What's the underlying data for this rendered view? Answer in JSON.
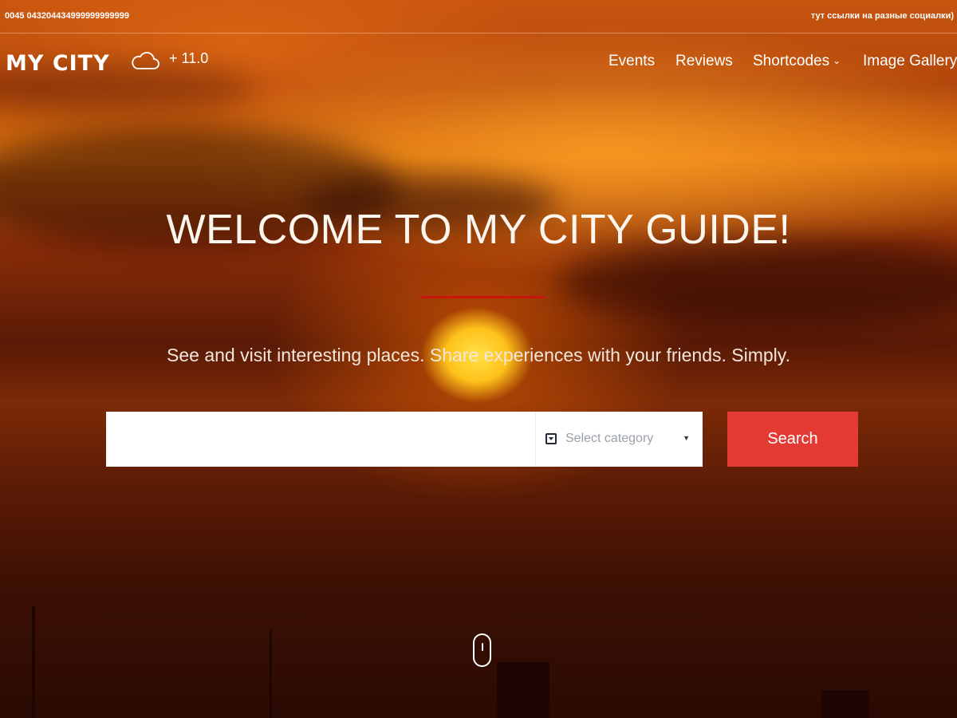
{
  "topbar": {
    "phone": "0045 043204434999999999999",
    "social_text": "тут ссылки на разные социалки)"
  },
  "header": {
    "logo": "MY CITY",
    "weather": {
      "icon": "cloud-icon",
      "temperature": "+ 11.0"
    }
  },
  "nav": {
    "items": [
      {
        "label": "Events"
      },
      {
        "label": "Reviews"
      },
      {
        "label": "Shortcodes",
        "has_dropdown": true
      },
      {
        "label": "Image Gallery"
      }
    ]
  },
  "hero": {
    "title": "WELCOME TO MY CITY GUIDE!",
    "subtitle": "See and visit interesting places. Share experiences with your friends. Simply.",
    "divider_color": "#c8160c"
  },
  "search": {
    "query": "",
    "category": {
      "icon": "dropdown-box-icon",
      "label": "Select category"
    },
    "button_label": "Search",
    "button_color": "#e33a33"
  },
  "scroll_hint": {
    "icon": "mouse-scroll-icon"
  }
}
